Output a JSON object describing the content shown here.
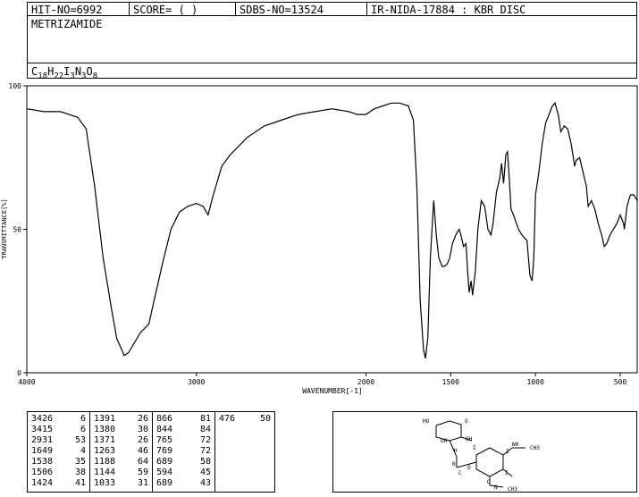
{
  "header": {
    "hit_no": "HIT-NO=6992",
    "score": "SCORE=  (  )",
    "sdbs_no": "SDBS-NO=13524",
    "ir_info": "IR-NIDA-17884 : KBR DISC"
  },
  "compound": {
    "name": "METRIZAMIDE",
    "formula_parts": [
      "C",
      "18",
      "H",
      "22",
      "I",
      "3",
      "N",
      "3",
      "O",
      "8"
    ]
  },
  "chart_data": {
    "type": "line",
    "xlabel": "WAVENUMBER[-1]",
    "ylabel": "TRANSMITTANCE[%]",
    "xlim": [
      4000,
      400
    ],
    "ylim": [
      0,
      100
    ],
    "x_ticks": [
      4000,
      3000,
      2000,
      1500,
      1000,
      500
    ],
    "y_ticks": [
      0,
      50,
      100
    ],
    "grid": false,
    "series": [
      {
        "points": [
          [
            4000,
            92
          ],
          [
            3900,
            91
          ],
          [
            3800,
            91
          ],
          [
            3700,
            89
          ],
          [
            3650,
            85
          ],
          [
            3600,
            65
          ],
          [
            3550,
            40
          ],
          [
            3500,
            22
          ],
          [
            3470,
            12
          ],
          [
            3440,
            8
          ],
          [
            3426,
            6
          ],
          [
            3400,
            7
          ],
          [
            3370,
            10
          ],
          [
            3330,
            14
          ],
          [
            3280,
            17
          ],
          [
            3250,
            25
          ],
          [
            3200,
            38
          ],
          [
            3150,
            50
          ],
          [
            3100,
            56
          ],
          [
            3050,
            58
          ],
          [
            3000,
            59
          ],
          [
            2960,
            58
          ],
          [
            2931,
            55
          ],
          [
            2900,
            62
          ],
          [
            2850,
            72
          ],
          [
            2800,
            76
          ],
          [
            2700,
            82
          ],
          [
            2600,
            86
          ],
          [
            2500,
            88
          ],
          [
            2400,
            90
          ],
          [
            2300,
            91
          ],
          [
            2200,
            92
          ],
          [
            2100,
            91
          ],
          [
            2050,
            90
          ],
          [
            2000,
            90
          ],
          [
            1950,
            92
          ],
          [
            1900,
            93
          ],
          [
            1850,
            94
          ],
          [
            1800,
            94
          ],
          [
            1750,
            93
          ],
          [
            1720,
            88
          ],
          [
            1700,
            65
          ],
          [
            1680,
            25
          ],
          [
            1660,
            8
          ],
          [
            1649,
            5
          ],
          [
            1635,
            12
          ],
          [
            1620,
            40
          ],
          [
            1600,
            60
          ],
          [
            1585,
            48
          ],
          [
            1570,
            40
          ],
          [
            1550,
            37
          ],
          [
            1538,
            37
          ],
          [
            1520,
            38
          ],
          [
            1506,
            40
          ],
          [
            1490,
            45
          ],
          [
            1470,
            48
          ],
          [
            1450,
            50
          ],
          [
            1440,
            48
          ],
          [
            1424,
            44
          ],
          [
            1410,
            45
          ],
          [
            1400,
            35
          ],
          [
            1391,
            28
          ],
          [
            1380,
            32
          ],
          [
            1371,
            27
          ],
          [
            1355,
            35
          ],
          [
            1340,
            50
          ],
          [
            1320,
            60
          ],
          [
            1300,
            58
          ],
          [
            1280,
            50
          ],
          [
            1263,
            48
          ],
          [
            1250,
            52
          ],
          [
            1230,
            63
          ],
          [
            1210,
            68
          ],
          [
            1200,
            73
          ],
          [
            1188,
            66
          ],
          [
            1175,
            76
          ],
          [
            1165,
            77
          ],
          [
            1155,
            68
          ],
          [
            1144,
            57
          ],
          [
            1130,
            55
          ],
          [
            1100,
            50
          ],
          [
            1080,
            48
          ],
          [
            1050,
            46
          ],
          [
            1033,
            34
          ],
          [
            1020,
            32
          ],
          [
            1010,
            40
          ],
          [
            1000,
            62
          ],
          [
            980,
            70
          ],
          [
            960,
            80
          ],
          [
            940,
            87
          ],
          [
            920,
            90
          ],
          [
            900,
            93
          ],
          [
            885,
            94
          ],
          [
            866,
            90
          ],
          [
            850,
            84
          ],
          [
            830,
            86
          ],
          [
            810,
            85
          ],
          [
            790,
            80
          ],
          [
            769,
            72
          ],
          [
            760,
            74
          ],
          [
            740,
            75
          ],
          [
            720,
            70
          ],
          [
            700,
            65
          ],
          [
            689,
            58
          ],
          [
            670,
            60
          ],
          [
            650,
            57
          ],
          [
            630,
            52
          ],
          [
            610,
            48
          ],
          [
            594,
            44
          ],
          [
            580,
            45
          ],
          [
            560,
            48
          ],
          [
            540,
            50
          ],
          [
            520,
            52
          ],
          [
            500,
            55
          ],
          [
            480,
            52
          ],
          [
            476,
            50
          ],
          [
            460,
            58
          ],
          [
            440,
            62
          ],
          [
            420,
            62
          ],
          [
            400,
            60
          ]
        ]
      }
    ]
  },
  "peak_table": [
    [
      [
        "3426",
        "6"
      ],
      [
        "3415",
        "6"
      ],
      [
        "2931",
        "53"
      ],
      [
        "1649",
        "4"
      ],
      [
        "1538",
        "35"
      ],
      [
        "1506",
        "38"
      ],
      [
        "1424",
        "41"
      ]
    ],
    [
      [
        "1391",
        "26"
      ],
      [
        "1380",
        "30"
      ],
      [
        "1371",
        "26"
      ],
      [
        "1263",
        "46"
      ],
      [
        "1188",
        "64"
      ],
      [
        "1144",
        "59"
      ],
      [
        "1033",
        "31"
      ]
    ],
    [
      [
        "866",
        "81"
      ],
      [
        "844",
        "84"
      ],
      [
        "765",
        "72"
      ],
      [
        "769",
        "72"
      ],
      [
        "689",
        "58"
      ],
      [
        "594",
        "45"
      ],
      [
        "689",
        "43"
      ]
    ],
    [
      [
        "476",
        "50"
      ]
    ]
  ],
  "structure_labels": [
    "HO",
    "O",
    "OH",
    "OH",
    "H",
    "N",
    "O",
    "I",
    "I",
    "I",
    "NH",
    "CH3",
    "N",
    "CH3",
    "O",
    "C"
  ]
}
